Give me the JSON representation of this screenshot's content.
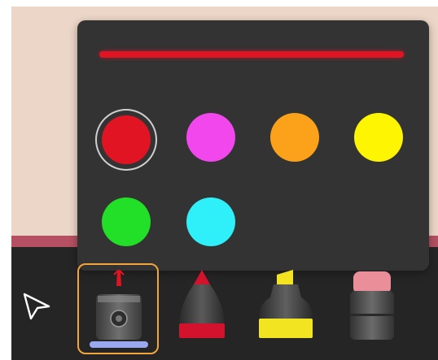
{
  "stroke_color": "#e01423",
  "selected_color_index": 0,
  "palette": [
    {
      "name": "red",
      "hex": "#e01423"
    },
    {
      "name": "magenta",
      "hex": "#f347ee"
    },
    {
      "name": "orange",
      "hex": "#fba11a"
    },
    {
      "name": "yellow",
      "hex": "#fef503"
    },
    {
      "name": "green",
      "hex": "#22e027"
    },
    {
      "name": "cyan",
      "hex": "#2ff0f8"
    }
  ],
  "tools": {
    "pointer": {
      "icon": "pointer-arrow-icon"
    },
    "pen": {
      "icon": "pen-icon",
      "selected": true,
      "accent": "#e01423",
      "size_bar": "#9aa8f0"
    },
    "marker": {
      "icon": "marker-icon",
      "accent": "#d3132d"
    },
    "highlighter": {
      "icon": "highlighter-icon",
      "accent": "#f2e420"
    },
    "eraser": {
      "icon": "eraser-icon",
      "accent": "#ea8f9a"
    }
  },
  "colors": {
    "backdrop": "#ecd6c7",
    "accent_band": "#b45061",
    "toolbar": "#252525",
    "popover": "#333333",
    "selection_ring": "#f4a53a"
  }
}
